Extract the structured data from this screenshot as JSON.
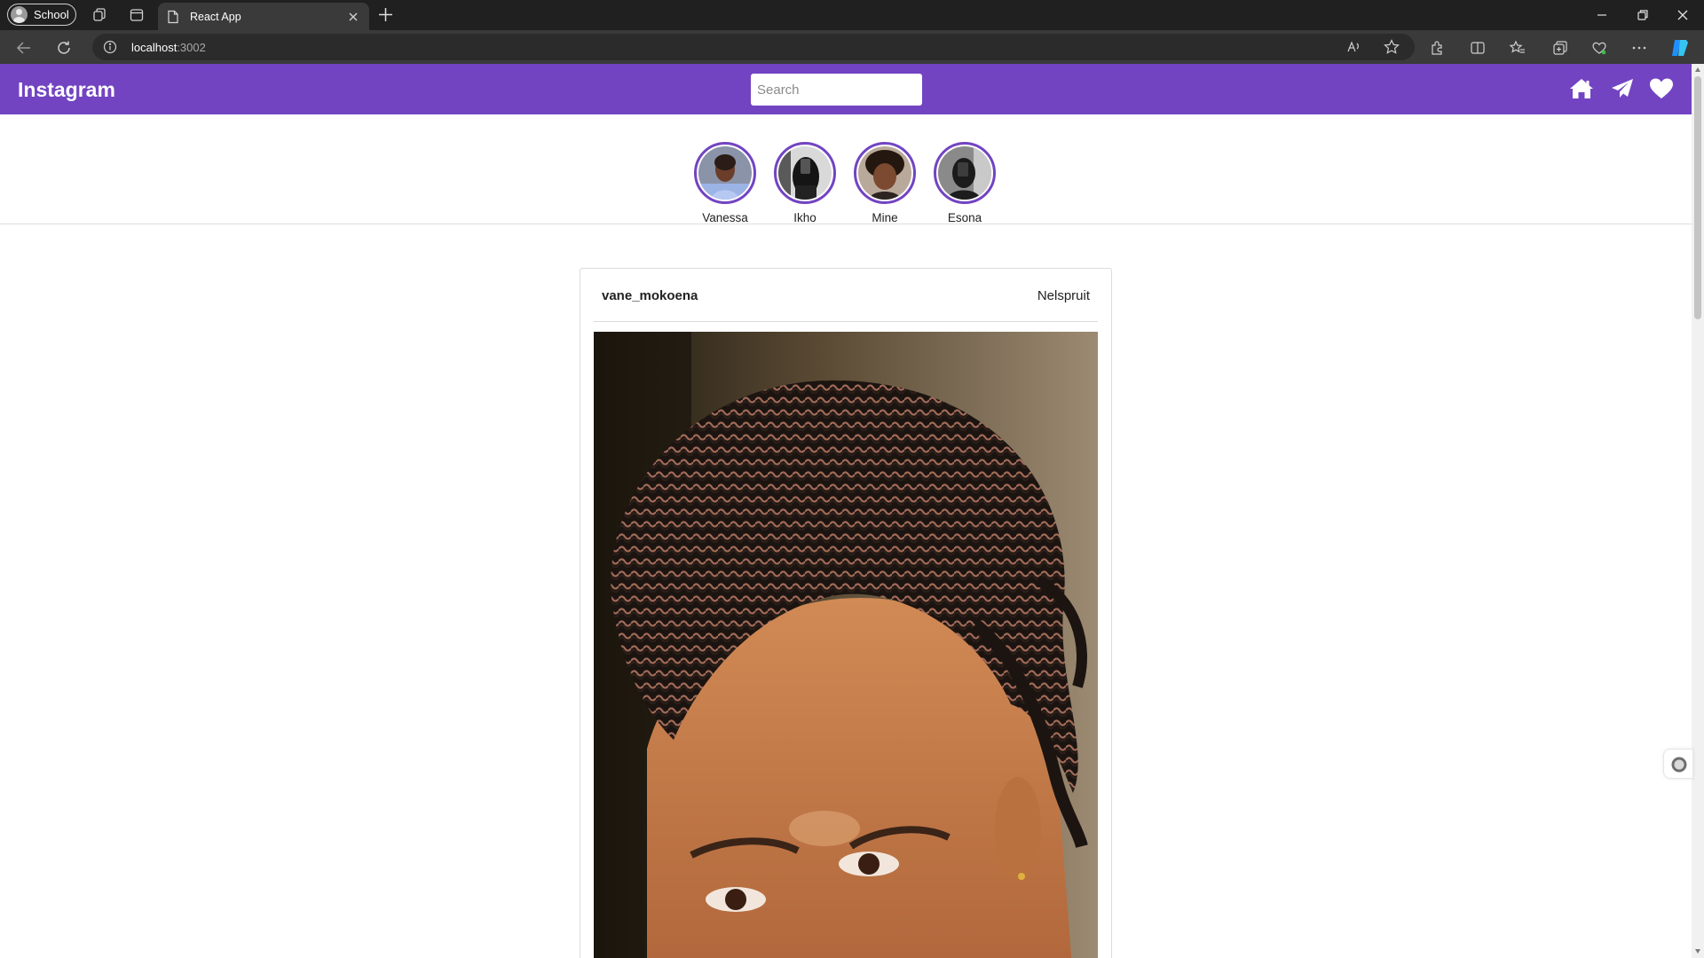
{
  "browser": {
    "profile_name": "School",
    "tab_title": "React App",
    "url_host": "localhost",
    "url_port": ":3002"
  },
  "app": {
    "brand": "Instagram",
    "search_placeholder": "Search",
    "nav_icons": [
      "home-icon",
      "paper-plane-icon",
      "heart-icon"
    ],
    "accent_color": "#7244c2"
  },
  "stories": [
    {
      "name": "Vanessa"
    },
    {
      "name": "Ikho"
    },
    {
      "name": "Mine"
    },
    {
      "name": "Esona"
    }
  ],
  "post": {
    "username": "vane_mokoena",
    "location": "Nelspruit"
  }
}
